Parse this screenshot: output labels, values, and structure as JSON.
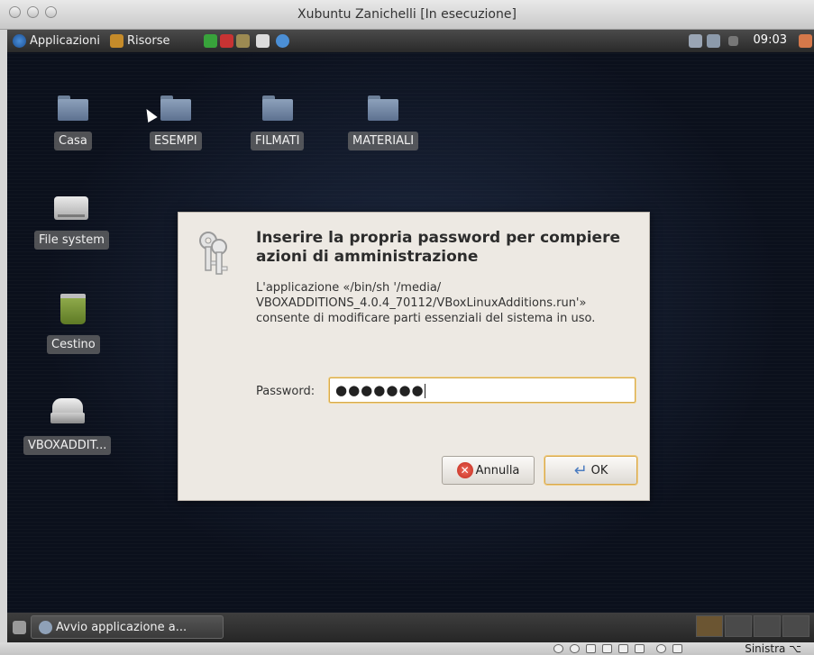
{
  "host_window": {
    "title": "Xubuntu Zanichelli [In esecuzione]",
    "host_key_label": "Sinistra ⌥"
  },
  "top_panel": {
    "applications_label": "Applicazioni",
    "places_label": "Risorse",
    "clock": "09:03"
  },
  "desktop_icons": {
    "casa": "Casa",
    "esempi": "ESEMPI",
    "filmati": "FILMATI",
    "materiali": "MATERIALI",
    "filesystem": "File system",
    "cestino": "Cestino",
    "vboxadditions": "VBOXADDIT..."
  },
  "dialog": {
    "title": "Inserire la propria password per compiere azioni di amministrazione",
    "message": "L'applicazione «/bin/sh '/media/\nVBOXADDITIONS_4.0.4_70112/VBoxLinuxAdditions.run'»\nconsente di modificare parti essenziali del sistema in uso.",
    "password_label": "Password:",
    "password_value": "●●●●●●●",
    "cancel_label": "Annulla",
    "ok_label": "OK"
  },
  "bottom_panel": {
    "task_label": "Avvio applicazione a..."
  },
  "colors": {
    "desktop_bg": "#0b101c",
    "dialog_bg": "#ede9e3",
    "focus_border": "#d6aa4e"
  }
}
